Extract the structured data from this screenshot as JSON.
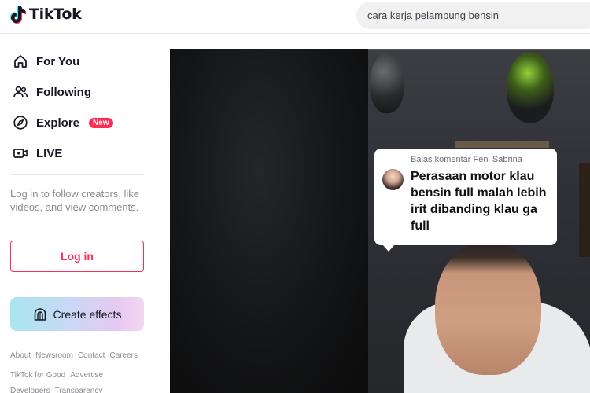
{
  "brand": {
    "name": "TikTok"
  },
  "search": {
    "query": "cara kerja pelampung bensin"
  },
  "nav": {
    "items": [
      {
        "label": "For You",
        "icon": "home-icon"
      },
      {
        "label": "Following",
        "icon": "people-icon"
      },
      {
        "label": "Explore",
        "icon": "compass-icon",
        "badge": "New"
      },
      {
        "label": "LIVE",
        "icon": "live-video-icon"
      }
    ]
  },
  "login_prompt": "Log in to follow creators, like videos, and view comments.",
  "login_button": "Log in",
  "effects_button": "Create effects",
  "footer": {
    "row1": [
      "About",
      "Newsroom",
      "Contact",
      "Careers"
    ],
    "row2": [
      "TikTok for Good",
      "Advertise"
    ],
    "row3": [
      "Developers",
      "Transparency"
    ]
  },
  "video": {
    "comment": {
      "header": "Balas komentar Feni Sabrina",
      "text": "Perasaan motor klau bensin full malah lebih irit dibanding klau ga full"
    }
  },
  "colors": {
    "accent": "#fe2c55",
    "text": "#161823",
    "muted": "#8a8b91"
  }
}
